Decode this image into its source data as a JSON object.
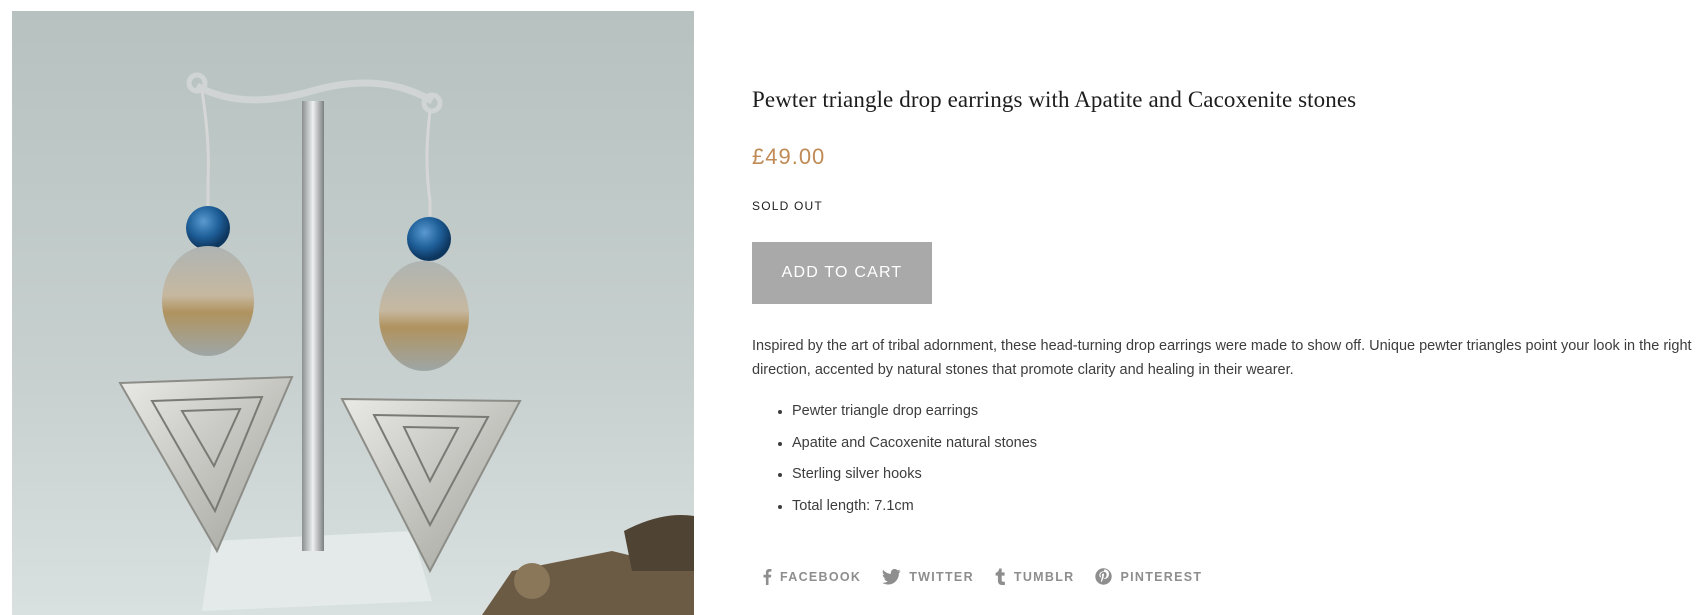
{
  "product": {
    "image_alt": "Pewter triangle drop earrings with blue apatite beads on a display stand",
    "title": "Pewter triangle drop earrings with Apatite and Cacoxenite stones",
    "price": "£49.00",
    "stock_status": "SOLD OUT",
    "add_to_cart_label": "ADD TO CART",
    "description": "Inspired by the art of tribal adornment, these head-turning drop earrings were made to show off. Unique pewter triangles point your look in the right direction, accented by natural stones that promote clarity and healing in their wearer.",
    "features": [
      "Pewter triangle drop earrings",
      "Apatite and Cacoxenite natural stones",
      "Sterling silver hooks",
      "Total length: 7.1cm"
    ]
  },
  "share": {
    "facebook": {
      "label": "FACEBOOK",
      "icon": "facebook-icon"
    },
    "twitter": {
      "label": "TWITTER",
      "icon": "twitter-icon"
    },
    "tumblr": {
      "label": "TUMBLR",
      "icon": "tumblr-icon"
    },
    "pinterest": {
      "label": "PINTEREST",
      "icon": "pinterest-icon"
    }
  },
  "colors": {
    "price": "#c08a55",
    "button": "#a9a9a9",
    "share_text": "#8e8e8e"
  }
}
